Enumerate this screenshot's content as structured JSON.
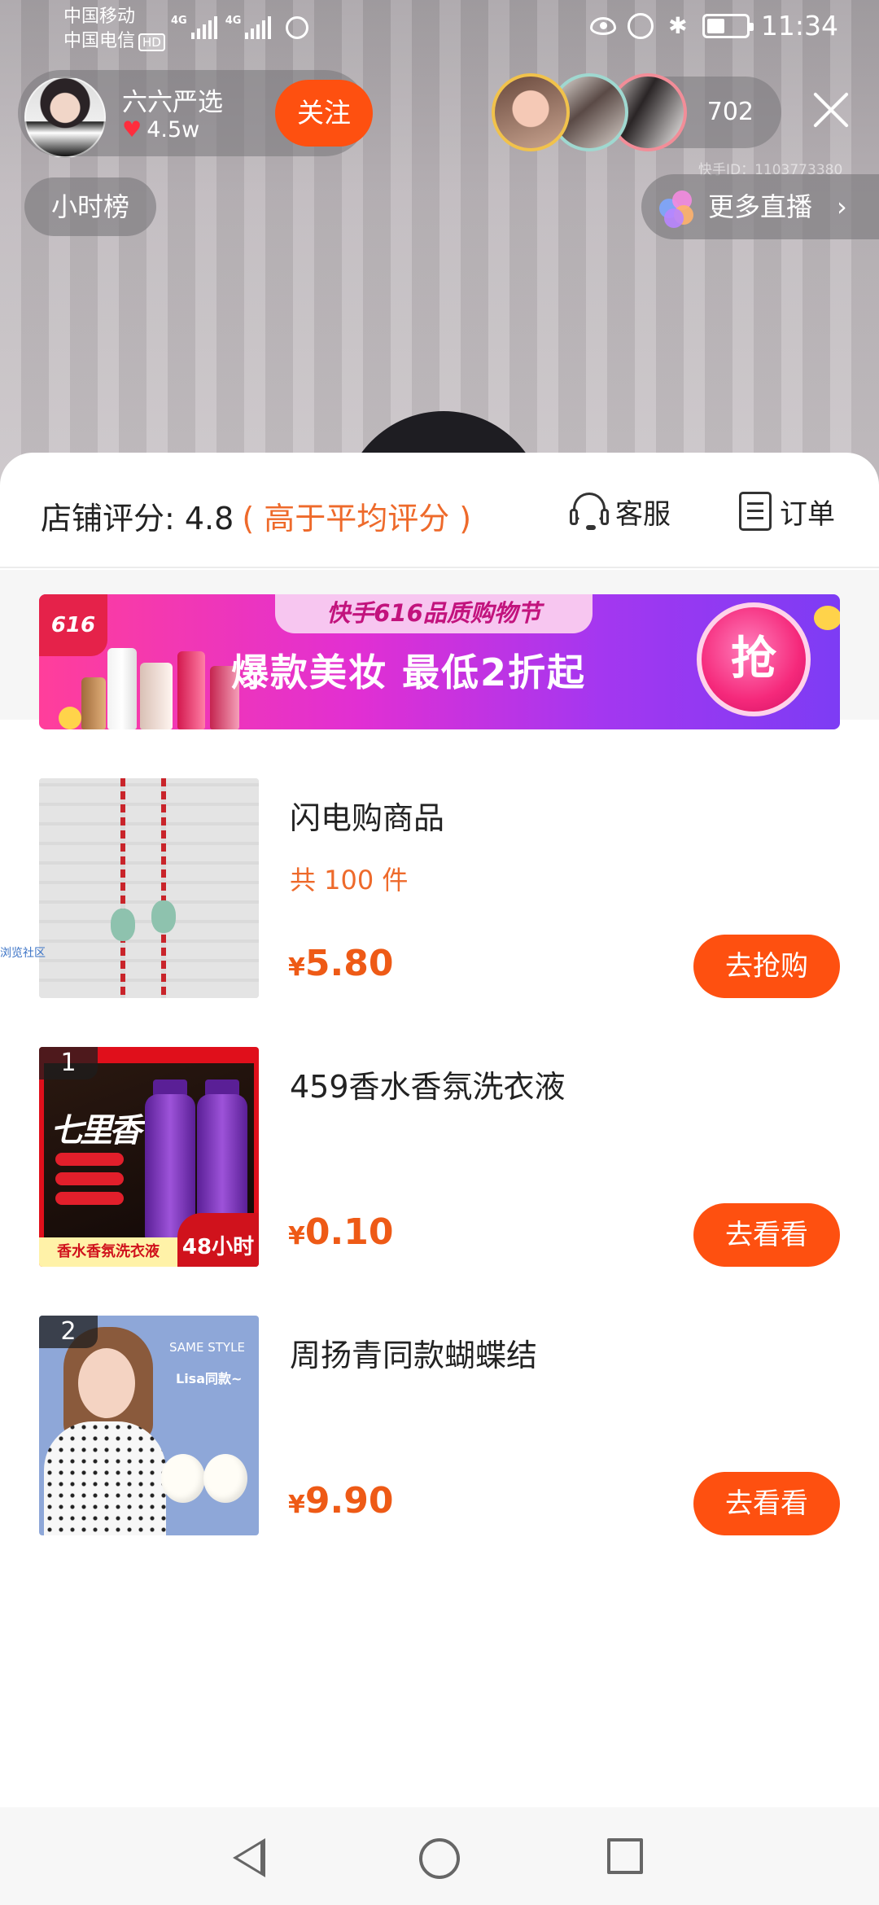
{
  "status_bar": {
    "carrier1": "中国移动",
    "carrier2": "中国电信",
    "hd": "HD",
    "net1": "4G",
    "net2": "4G",
    "time": "11:34"
  },
  "anchor": {
    "name": "六六严选",
    "likes": "4.5w",
    "follow_label": "关注"
  },
  "viewers": {
    "count": "702",
    "kuaishou_id": "快手ID：1103773380"
  },
  "live": {
    "hour_rank_label": "小时榜",
    "more_live_label": "更多直播",
    "more_chevron": "›"
  },
  "shop": {
    "score_label": "店铺评分: 4.8",
    "score_note": "( 高于平均评分 )",
    "service_label": "客服",
    "order_label": "订单"
  },
  "banner": {
    "logo_text": "616",
    "top_tag": "快手616品质购物节",
    "main_text": "爆款美妆 最低2折起",
    "grab_label": "抢"
  },
  "products": [
    {
      "title": "闪电购商品",
      "count": "共 100 件",
      "currency": "¥",
      "price": "5.80",
      "button": "去抢购"
    },
    {
      "rank": "1",
      "title": "459香水香氛洗衣液",
      "currency": "¥",
      "price": "0.10",
      "button": "去看看",
      "thumb_foot": "香水香氛洗衣液",
      "thumb_badge": "48小时"
    },
    {
      "rank": "2",
      "title": "周扬青同款蝴蝶结",
      "currency": "¥",
      "price": "9.90",
      "button": "去看看",
      "thumb_same": "SAME STYLE",
      "thumb_lisa": "Lisa同款~"
    }
  ],
  "side_tag": "浏览社区",
  "colors": {
    "accent": "#fe5010",
    "price": "#ee5a16",
    "note": "#ee6a2b"
  }
}
